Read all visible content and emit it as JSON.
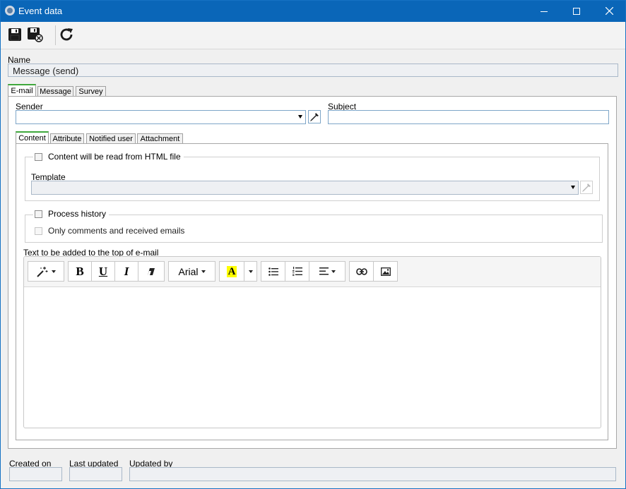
{
  "window": {
    "title": "Event data"
  },
  "toolbar": {
    "save_icon": "save-icon",
    "save_close_icon": "save-close-icon",
    "refresh_icon": "refresh-icon"
  },
  "name": {
    "label": "Name",
    "value": "Message (send)"
  },
  "main_tabs": [
    {
      "label": "E-mail",
      "active": true
    },
    {
      "label": "Message"
    },
    {
      "label": "Survey"
    }
  ],
  "email": {
    "sender_label": "Sender",
    "sender_value": "",
    "subject_label": "Subject",
    "subject_value": ""
  },
  "sub_tabs": [
    {
      "label": "Content",
      "active": true
    },
    {
      "label": "Attribute"
    },
    {
      "label": "Notified user"
    },
    {
      "label": "Attachment"
    }
  ],
  "content": {
    "html_file_checkbox": "Content will be read from HTML file",
    "html_file_checked": false,
    "template_label": "Template",
    "template_value": "",
    "process_history_checkbox": "Process history",
    "process_history_checked": false,
    "only_comments_checkbox": "Only comments and received emails",
    "only_comments_checked": false,
    "top_text_label": "Text to be added to the top of e-mail"
  },
  "editor": {
    "font_name": "Arial",
    "bold": "B",
    "underline": "U",
    "italic": "I",
    "highlight_letter": "A",
    "highlight_color": "#ffff00",
    "body": ""
  },
  "footer": {
    "created_label": "Created on",
    "updated_label": "Last updated",
    "updated_by_label": "Updated by",
    "created_value": "",
    "updated_value": "",
    "updated_by_value": ""
  },
  "colors": {
    "titlebar": "#0a66b8",
    "active_tab_accent": "#3fa83c"
  }
}
